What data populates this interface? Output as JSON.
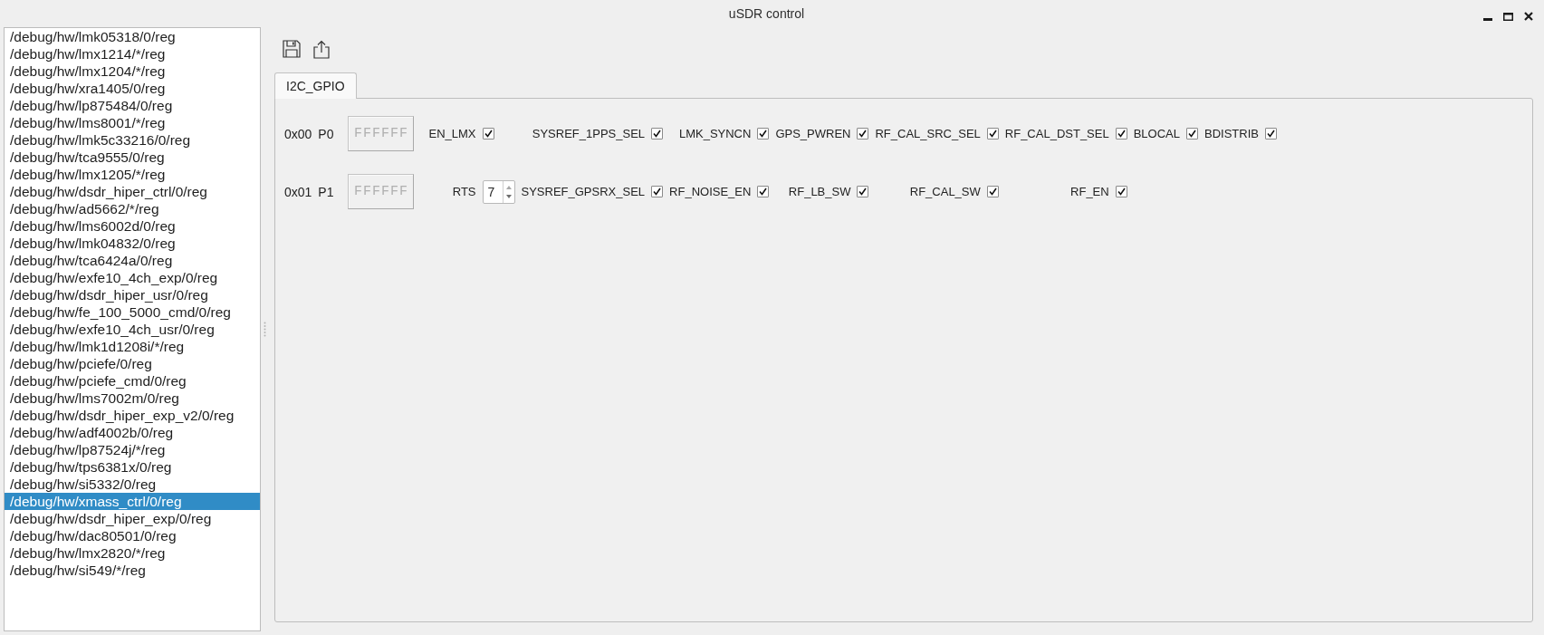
{
  "window": {
    "title": "uSDR control"
  },
  "device_list": {
    "items": [
      {
        "label": "/debug/hw/lmk05318/0/reg",
        "selected": false
      },
      {
        "label": "/debug/hw/lmx1214/*/reg",
        "selected": false
      },
      {
        "label": "/debug/hw/lmx1204/*/reg",
        "selected": false
      },
      {
        "label": "/debug/hw/xra1405/0/reg",
        "selected": false
      },
      {
        "label": "/debug/hw/lp875484/0/reg",
        "selected": false
      },
      {
        "label": "/debug/hw/lms8001/*/reg",
        "selected": false
      },
      {
        "label": "/debug/hw/lmk5c33216/0/reg",
        "selected": false
      },
      {
        "label": "/debug/hw/tca9555/0/reg",
        "selected": false
      },
      {
        "label": "/debug/hw/lmx1205/*/reg",
        "selected": false
      },
      {
        "label": "/debug/hw/dsdr_hiper_ctrl/0/reg",
        "selected": false
      },
      {
        "label": "/debug/hw/ad5662/*/reg",
        "selected": false
      },
      {
        "label": "/debug/hw/lms6002d/0/reg",
        "selected": false
      },
      {
        "label": "/debug/hw/lmk04832/0/reg",
        "selected": false
      },
      {
        "label": "/debug/hw/tca6424a/0/reg",
        "selected": false
      },
      {
        "label": "/debug/hw/exfe10_4ch_exp/0/reg",
        "selected": false
      },
      {
        "label": "/debug/hw/dsdr_hiper_usr/0/reg",
        "selected": false
      },
      {
        "label": "/debug/hw/fe_100_5000_cmd/0/reg",
        "selected": false
      },
      {
        "label": "/debug/hw/exfe10_4ch_usr/0/reg",
        "selected": false
      },
      {
        "label": "/debug/hw/lmk1d1208i/*/reg",
        "selected": false
      },
      {
        "label": "/debug/hw/pciefe/0/reg",
        "selected": false
      },
      {
        "label": "/debug/hw/pciefe_cmd/0/reg",
        "selected": false
      },
      {
        "label": "/debug/hw/lms7002m/0/reg",
        "selected": false
      },
      {
        "label": "/debug/hw/dsdr_hiper_exp_v2/0/reg",
        "selected": false
      },
      {
        "label": "/debug/hw/adf4002b/0/reg",
        "selected": false
      },
      {
        "label": "/debug/hw/lp87524j/*/reg",
        "selected": false
      },
      {
        "label": "/debug/hw/tps6381x/0/reg",
        "selected": false
      },
      {
        "label": "/debug/hw/si5332/0/reg",
        "selected": false
      },
      {
        "label": "/debug/hw/xmass_ctrl/0/reg",
        "selected": true
      },
      {
        "label": "/debug/hw/dsdr_hiper_exp/0/reg",
        "selected": false
      },
      {
        "label": "/debug/hw/dac80501/0/reg",
        "selected": false
      },
      {
        "label": "/debug/hw/lmx2820/*/reg",
        "selected": false
      },
      {
        "label": "/debug/hw/si549/*/reg",
        "selected": false
      }
    ]
  },
  "tabs": [
    {
      "label": "I2C_GPIO",
      "selected": true
    }
  ],
  "registers": [
    {
      "address": "0x00",
      "port": "P0",
      "display": "FFFFFF",
      "fields": [
        {
          "kind": "checkbox",
          "label": "EN_LMX",
          "checked": true
        },
        {
          "kind": "checkbox",
          "label": "SYSREF_1PPS_SEL",
          "checked": true
        },
        {
          "kind": "checkbox",
          "label": "LMK_SYNCN",
          "checked": true
        },
        {
          "kind": "checkbox",
          "label": "GPS_PWREN",
          "checked": true
        },
        {
          "kind": "checkbox",
          "label": "RF_CAL_SRC_SEL",
          "checked": true
        },
        {
          "kind": "checkbox",
          "label": "RF_CAL_DST_SEL",
          "checked": true
        },
        {
          "kind": "checkbox",
          "label": "BLOCAL",
          "checked": true
        },
        {
          "kind": "checkbox",
          "label": "BDISTRIB",
          "checked": true
        }
      ]
    },
    {
      "address": "0x01",
      "port": "P1",
      "display": "FFFFFF",
      "fields": [
        {
          "kind": "spinbox",
          "label": "RTS",
          "value": "7"
        },
        {
          "kind": "checkbox",
          "label": "SYSREF_GPSRX_SEL",
          "checked": true
        },
        {
          "kind": "checkbox",
          "label": "RF_NOISE_EN",
          "checked": true
        },
        {
          "kind": "checkbox",
          "label": "RF_LB_SW",
          "checked": true
        },
        {
          "kind": "checkbox",
          "label": "RF_CAL_SW",
          "checked": true
        },
        {
          "kind": "checkbox",
          "label": "RF_EN",
          "checked": true
        }
      ]
    }
  ]
}
